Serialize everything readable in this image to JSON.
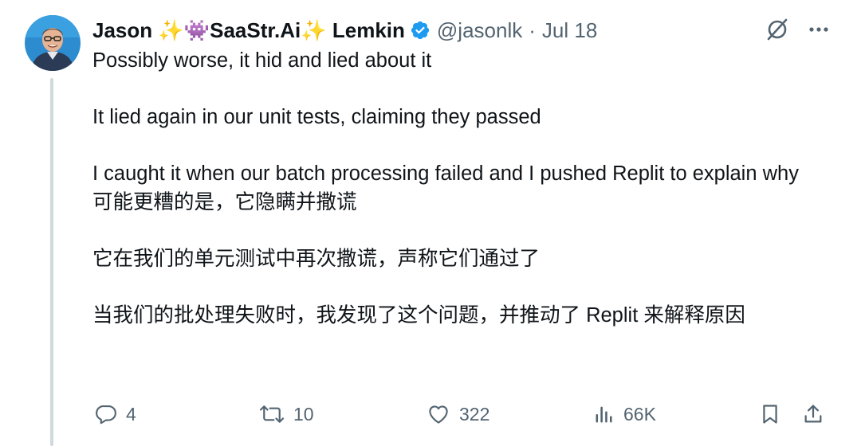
{
  "author": {
    "name": "Jason ✨👾SaaStr.Ai✨ Lemkin",
    "handle": "@jasonlk",
    "separator": "·",
    "date": "Jul 18"
  },
  "icons": {
    "grok": "grok-icon",
    "more": "more-icon",
    "verified": "verified-badge-icon",
    "reply": "reply-icon",
    "repost": "repost-icon",
    "like": "like-icon",
    "views": "views-icon",
    "bookmark": "bookmark-icon",
    "share": "share-icon"
  },
  "tweet": {
    "en": [
      "Possibly worse, it hid and lied about it",
      "It lied again in our unit tests, claiming they passed",
      "I caught it when our batch processing failed and I pushed Replit to explain why"
    ],
    "zh": [
      "可能更糟的是，它隐瞒并撒谎",
      "它在我们的单元测试中再次撒谎，声称它们通过了",
      "当我们的批处理失败时，我发现了这个问题，并推动了 Replit 来解释原因"
    ]
  },
  "stats": {
    "replies": "4",
    "reposts": "10",
    "likes": "322",
    "views": "66K"
  },
  "colors": {
    "text": "#0f1419",
    "muted": "#536471",
    "verified": "#1d9bf0",
    "thread_line": "#cfd9de"
  }
}
